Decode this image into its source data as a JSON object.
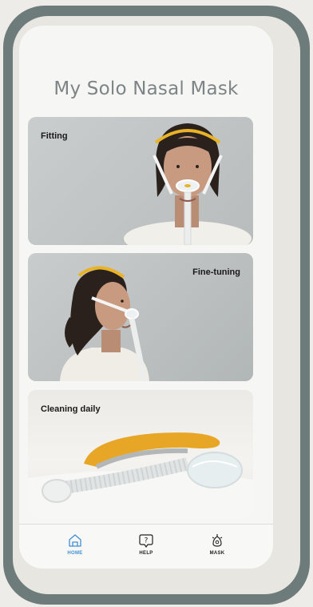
{
  "page": {
    "title": "My Solo Nasal Mask"
  },
  "cards": [
    {
      "label": "Fitting",
      "image": "woman-wearing-nasal-mask-front"
    },
    {
      "label": "Fine-tuning",
      "image": "woman-wearing-nasal-mask-side"
    },
    {
      "label": "Cleaning daily",
      "image": "mask-parts-on-towel"
    }
  ],
  "tabbar": {
    "home": {
      "label": "HOME",
      "icon": "home-icon"
    },
    "help": {
      "label": "HELP",
      "icon": "help-icon"
    },
    "mask": {
      "label": "MASK",
      "icon": "mask-icon"
    }
  },
  "colors": {
    "frame": "#6e7b7b",
    "title": "#7d8486",
    "accent": "#3f8fd2",
    "headgear": "#e9b327"
  }
}
